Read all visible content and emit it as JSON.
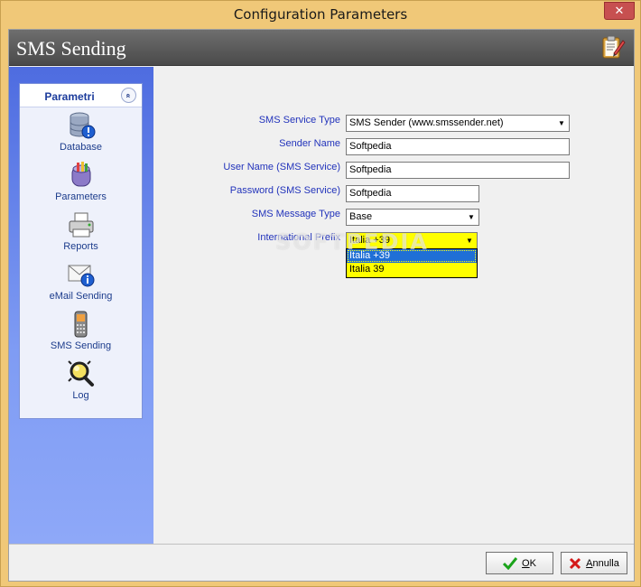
{
  "window": {
    "title": "Configuration Parameters",
    "close_glyph": "✕"
  },
  "header": {
    "title": "SMS Sending",
    "icon": "clipboard-edit-icon"
  },
  "nav": {
    "title": "Parametri",
    "collapse_glyph": "«",
    "items": [
      {
        "label": "Database",
        "icon": "database-icon"
      },
      {
        "label": "Parameters",
        "icon": "parameters-icon"
      },
      {
        "label": "Reports",
        "icon": "printer-icon"
      },
      {
        "label": "eMail Sending",
        "icon": "email-icon"
      },
      {
        "label": "SMS Sending",
        "icon": "mobile-phone-icon"
      },
      {
        "label": "Log",
        "icon": "log-magnifier-icon"
      }
    ]
  },
  "form": {
    "sms_service_type": {
      "label": "SMS Service Type",
      "value": "SMS Sender (www.smssender.net)"
    },
    "sender_name": {
      "label": "Sender Name",
      "value": "Softpedia"
    },
    "user_name": {
      "label": "User Name (SMS Service)",
      "value": "Softpedia"
    },
    "password": {
      "label": "Password (SMS Service)",
      "value": "Softpedia"
    },
    "message_type": {
      "label": "SMS Message Type",
      "value": "Base"
    },
    "international_prefix": {
      "label": "International Prefix",
      "value": "Italia +39",
      "options": [
        "Italia +39",
        "Italia 39"
      ]
    }
  },
  "watermark": "SOFTPEDIA",
  "footer": {
    "ok": {
      "label_accel": "O",
      "label_rest": "K"
    },
    "cancel": {
      "label_accel": "A",
      "label_rest": "nnulla"
    }
  },
  "colors": {
    "accent_blue": "#1c3c8c",
    "highlight_yellow": "#ffff00",
    "selection_blue": "#1f6fd6"
  }
}
